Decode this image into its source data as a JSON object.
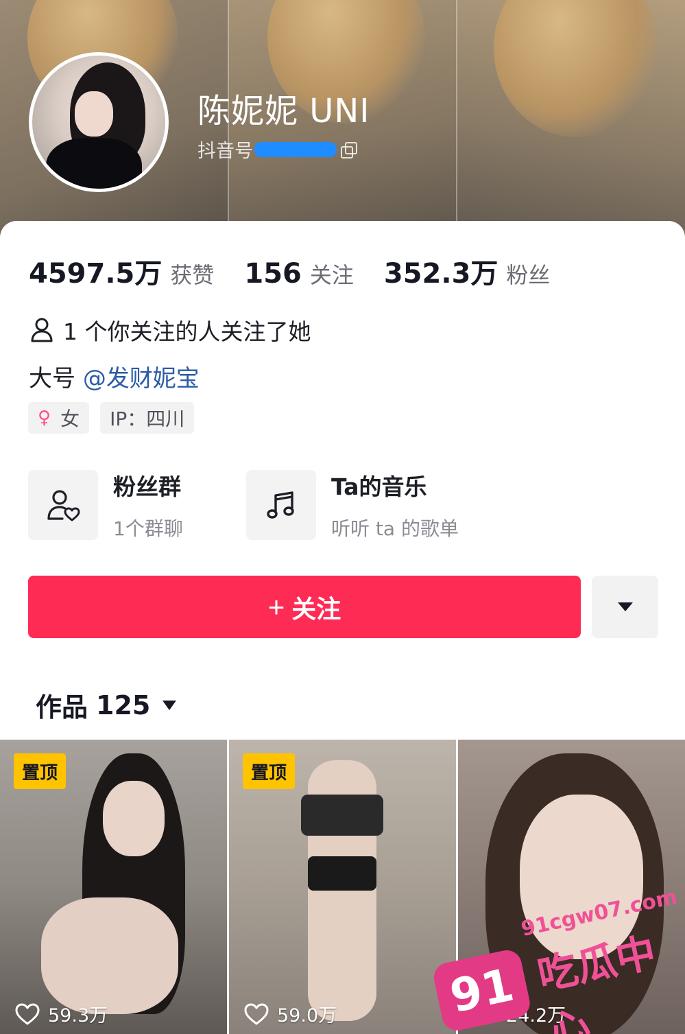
{
  "profile": {
    "name": "陈妮妮 UNI",
    "douyin_id_label": "抖音号"
  },
  "stats": [
    {
      "value": "4597.5万",
      "label": "获赞"
    },
    {
      "value": "156",
      "label": "关注"
    },
    {
      "value": "352.3万",
      "label": "粉丝"
    }
  ],
  "mutual": {
    "text": "1 个你关注的人关注了她"
  },
  "bio": {
    "prefix": "大号",
    "mention": "@发财妮宝"
  },
  "tags": {
    "gender": "女",
    "ip": "IP：四川"
  },
  "features": [
    {
      "title": "粉丝群",
      "subtitle": "1个群聊",
      "icon": "fan-group-icon"
    },
    {
      "title": "Ta的音乐",
      "subtitle": "听听 ta 的歌单",
      "icon": "music-note-icon"
    }
  ],
  "actions": {
    "follow_label": "关注"
  },
  "works": {
    "label": "作品",
    "count": "125"
  },
  "videos": [
    {
      "pinned": "置顶",
      "likes": "59.3万"
    },
    {
      "pinned": "置顶",
      "likes": "59.0万"
    },
    {
      "pinned": "",
      "likes": "24.2万"
    }
  ],
  "watermark": {
    "badge": "91",
    "url": "91cgw07.com",
    "text": "吃瓜中心"
  },
  "colors": {
    "primary": "#fe2c55",
    "mention": "#2c5ba8",
    "pin": "#ffc300",
    "watermark": "#e33a86"
  }
}
